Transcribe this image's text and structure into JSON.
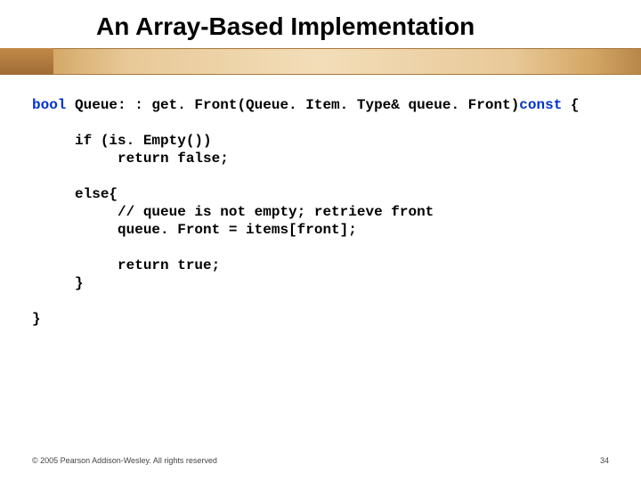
{
  "title": "An Array-Based Implementation",
  "code": {
    "l1a": "bool",
    "l1b": " Queue: : get. Front(Queue. Item. Type& queue. Front)",
    "l1c": "const",
    "l1d": " {",
    "l2": "     if (is. Empty())",
    "l3": "          return false;",
    "l4": "     else{",
    "l5": "          // queue is not empty; retrieve front",
    "l6": "          queue. Front = items[front];",
    "l7": "          return true;",
    "l8": "     }",
    "l9": "}"
  },
  "footer": {
    "copyright": "© 2005 Pearson Addison-Wesley. All rights reserved",
    "page": "34"
  }
}
